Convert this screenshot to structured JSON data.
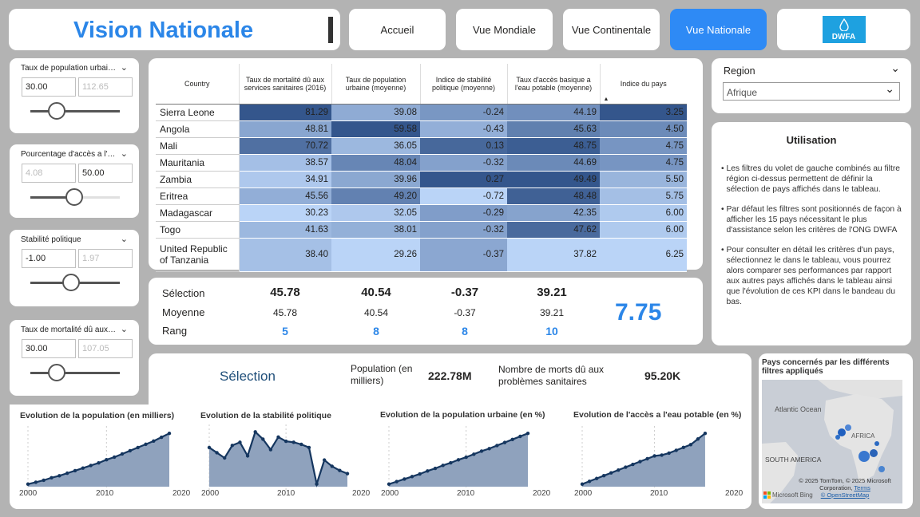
{
  "header": {
    "title": "Vision Nationale"
  },
  "nav": [
    {
      "label": "Accueil"
    },
    {
      "label": "Vue Mondiale"
    },
    {
      "label": "Vue Continentale"
    },
    {
      "label": "Vue Nationale"
    }
  ],
  "logo": {
    "text": "DWFA",
    "color": "#1ea1e0"
  },
  "slicers": [
    {
      "label": "Taux de population urbaine",
      "min": "30.00",
      "max": "112.65",
      "knob": 0.15
    },
    {
      "label": "Pourcentage d'accès a l'eau potable",
      "min": "4.08",
      "max": "50.00",
      "knob": 0.55
    },
    {
      "label": "Stabilité politique",
      "min": "-1.00",
      "max": "1.97",
      "knob": 0.5
    },
    {
      "label": "Taux de mortalité dû aux problèmes sanitaires",
      "min": "30.00",
      "max": "107.05",
      "knob": 0.28
    }
  ],
  "region": {
    "label": "Region",
    "value": "Afrique"
  },
  "table": {
    "headers": [
      "Country",
      "Taux de mortalité dû aux services sanitaires (2016)",
      "Taux de population urbaine (moyenne)",
      "Indice de stabilité politique (moyenne)",
      "Taux d'accès basique a l'eau potable (moyenne)",
      "Indice du pays"
    ],
    "rows": [
      [
        "Sierra Leone",
        "81.29",
        "39.08",
        "-0.24",
        "44.19",
        "3.25"
      ],
      [
        "Angola",
        "48.81",
        "59.58",
        "-0.43",
        "45.63",
        "4.50"
      ],
      [
        "Mali",
        "70.72",
        "36.05",
        "0.13",
        "48.75",
        "4.75"
      ],
      [
        "Mauritania",
        "38.57",
        "48.04",
        "-0.32",
        "44.69",
        "4.75"
      ],
      [
        "Zambia",
        "34.91",
        "39.96",
        "0.27",
        "49.49",
        "5.50"
      ],
      [
        "Eritrea",
        "45.56",
        "49.20",
        "-0.72",
        "48.48",
        "5.75"
      ],
      [
        "Madagascar",
        "30.23",
        "32.05",
        "-0.29",
        "42.35",
        "6.00"
      ],
      [
        "Togo",
        "41.63",
        "38.01",
        "-0.32",
        "47.62",
        "6.00"
      ],
      [
        "United Republic of Tanzania",
        "38.40",
        "29.26",
        "-0.37",
        "37.82",
        "6.25"
      ]
    ]
  },
  "usage": {
    "title": "Utilisation",
    "bullets": [
      "Les filtres du volet de gauche combinés au filtre région ci-dessus permettent de définir la sélection de pays affichés dans le tableau.",
      "Par défaut les filtres sont positionnés de façon à afficher les 15 pays nécessitant le plus d'assistance selon les critères de l'ONG DWFA",
      "Pour consulter en détail les critères d'un pays, sélectionnez le dans le tableau, vous pourrez alors comparer ses performances par rapport aux autres pays affichés dans le tableau ainsi que l'évolution de ces KPI dans le bandeau du bas."
    ]
  },
  "kpi": {
    "labels": [
      "Sélection",
      "Moyenne",
      "Rang"
    ],
    "selection": [
      "45.78",
      "40.54",
      "-0.37",
      "39.21"
    ],
    "moyenne": [
      "45.78",
      "40.54",
      "-0.37",
      "39.21"
    ],
    "rang": [
      "5",
      "8",
      "8",
      "10"
    ],
    "index": "7.75"
  },
  "bottom": {
    "selection_title": "Sélection",
    "pop_label": "Population (en milliers)",
    "pop_value": "222.78M",
    "deaths_label": "Nombre de morts dû aux problèmes sanitaires",
    "deaths_value": "95.20K"
  },
  "map": {
    "title": "Pays concernés par les différents filtres appliqués",
    "ocean": "Atlantic Ocean",
    "africa": "AFRICA",
    "samerica": "SOUTH AMERICA",
    "copyright": "© 2025 TomTom, © 2025 Microsoft Corporation,",
    "terms": "Terms",
    "osm": "© OpenStreetMap",
    "bing": "Microsoft Bing"
  },
  "chart_data": [
    {
      "type": "area",
      "title": "Evolution de la population (en milliers)",
      "x": [
        2000,
        2001,
        2002,
        2003,
        2004,
        2005,
        2006,
        2007,
        2008,
        2009,
        2010,
        2011,
        2012,
        2013,
        2014,
        2015,
        2016,
        2017,
        2018
      ],
      "values": [
        1,
        1.03,
        1.06,
        1.1,
        1.13,
        1.17,
        1.21,
        1.25,
        1.29,
        1.33,
        1.38,
        1.42,
        1.47,
        1.52,
        1.57,
        1.62,
        1.67,
        1.73,
        1.79
      ],
      "xticks": [
        "2000",
        "2010",
        "2020"
      ]
    },
    {
      "type": "area",
      "title": "Evolution de la stabilité politique",
      "x": [
        2000,
        2001,
        2002,
        2003,
        2004,
        2005,
        2006,
        2007,
        2008,
        2009,
        2010,
        2011,
        2012,
        2013,
        2014,
        2015,
        2016,
        2017,
        2018
      ],
      "values": [
        -0.3,
        -0.35,
        -0.4,
        -0.28,
        -0.25,
        -0.38,
        -0.15,
        -0.22,
        -0.32,
        -0.2,
        -0.24,
        -0.25,
        -0.27,
        -0.3,
        -0.65,
        -0.42,
        -0.48,
        -0.52,
        -0.55
      ],
      "xticks": [
        "2000",
        "2010",
        "2020"
      ]
    },
    {
      "type": "area",
      "title": "Evolution de la population urbaine (en %)",
      "x": [
        2000,
        2001,
        2002,
        2003,
        2004,
        2005,
        2006,
        2007,
        2008,
        2009,
        2010,
        2011,
        2012,
        2013,
        2014,
        2015,
        2016,
        2017,
        2018
      ],
      "values": [
        22,
        22.5,
        23,
        23.5,
        24,
        24.6,
        25.1,
        25.7,
        26.2,
        26.8,
        27.3,
        27.9,
        28.5,
        29,
        29.6,
        30.2,
        30.8,
        31.4,
        32
      ],
      "xticks": [
        "2000",
        "2010",
        "2020"
      ]
    },
    {
      "type": "area",
      "title": "Evolution de l'accès a l'eau potable (en %)",
      "x": [
        2000,
        2001,
        2002,
        2003,
        2004,
        2005,
        2006,
        2007,
        2008,
        2009,
        2010,
        2011,
        2012,
        2013,
        2014,
        2015,
        2016,
        2017
      ],
      "values": [
        26,
        27,
        28,
        29,
        30,
        31,
        32,
        33,
        34,
        35,
        36,
        36.3,
        37,
        38,
        39,
        40,
        42,
        44
      ],
      "xticks": [
        "2000",
        "2010",
        "2020"
      ]
    }
  ]
}
